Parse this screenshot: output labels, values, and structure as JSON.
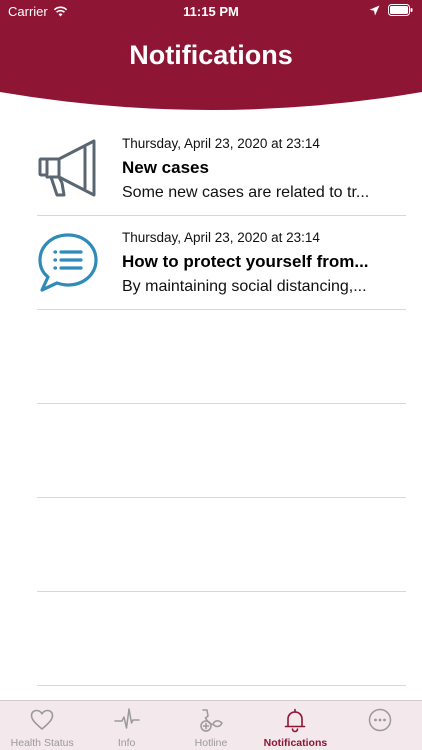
{
  "colors": {
    "brand": "#8f1535",
    "icon_gray": "#5a6773",
    "icon_blue": "#2f8bb8",
    "tab_inactive": "#9a9a9a"
  },
  "status_bar": {
    "carrier": "Carrier",
    "time": "11:15 PM"
  },
  "header": {
    "title": "Notifications"
  },
  "notifications": [
    {
      "icon": "megaphone-icon",
      "date": "Thursday, April 23, 2020 at 23:14",
      "title": "New cases",
      "body": "Some new cases are related to tr..."
    },
    {
      "icon": "chat-bubble-icon",
      "date": "Thursday, April 23, 2020 at 23:14",
      "title": "How to protect yourself from...",
      "body": "By maintaining social distancing,..."
    }
  ],
  "tabbar": {
    "items": [
      {
        "label": "Health Status",
        "icon": "heart-icon",
        "active": false
      },
      {
        "label": "Info",
        "icon": "pulse-icon",
        "active": false
      },
      {
        "label": "Hotline",
        "icon": "hotline-icon",
        "active": false
      },
      {
        "label": "Notifications",
        "icon": "bell-icon",
        "active": true
      },
      {
        "label": "",
        "icon": "more-icon",
        "active": false
      }
    ]
  }
}
